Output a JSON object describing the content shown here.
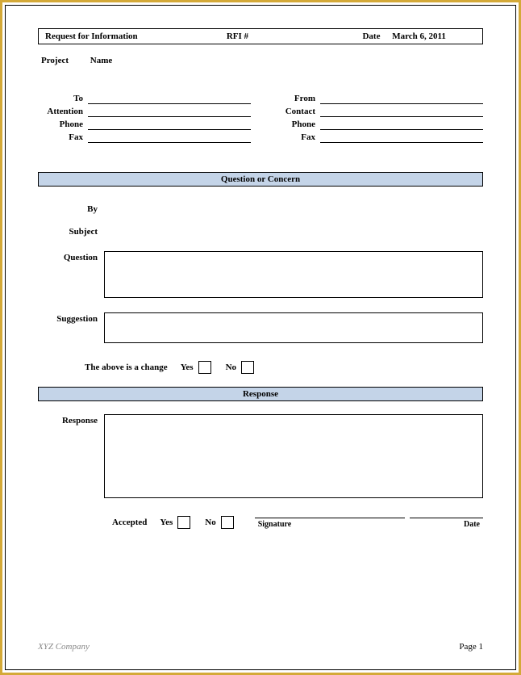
{
  "header": {
    "title": "Request for Information",
    "rfi_label": "RFI #",
    "rfi_number": "",
    "date_label": "Date",
    "date_value": "March 6, 2011"
  },
  "project": {
    "label": "Project",
    "name_label": "Name",
    "name_value": ""
  },
  "contacts": {
    "left": {
      "to": {
        "label": "To",
        "value": ""
      },
      "attention": {
        "label": "Attention",
        "value": ""
      },
      "phone": {
        "label": "Phone",
        "value": ""
      },
      "fax": {
        "label": "Fax",
        "value": ""
      }
    },
    "right": {
      "from": {
        "label": "From",
        "value": ""
      },
      "contact": {
        "label": "Contact",
        "value": ""
      },
      "phone": {
        "label": "Phone",
        "value": ""
      },
      "fax": {
        "label": "Fax",
        "value": ""
      }
    }
  },
  "section_question": {
    "heading": "Question or Concern",
    "by_label": "By",
    "by_value": "",
    "subject_label": "Subject",
    "subject_value": "",
    "question_label": "Question",
    "question_value": "",
    "suggestion_label": "Suggestion",
    "suggestion_value": "",
    "change_text": "The above is a change",
    "yes_label": "Yes",
    "no_label": "No"
  },
  "section_response": {
    "heading": "Response",
    "response_label": "Response",
    "response_value": "",
    "accepted_label": "Accepted",
    "yes_label": "Yes",
    "no_label": "No",
    "signature_label": "Signature",
    "date_label": "Date"
  },
  "footer": {
    "company": "XYZ Company",
    "page": "Page 1"
  }
}
